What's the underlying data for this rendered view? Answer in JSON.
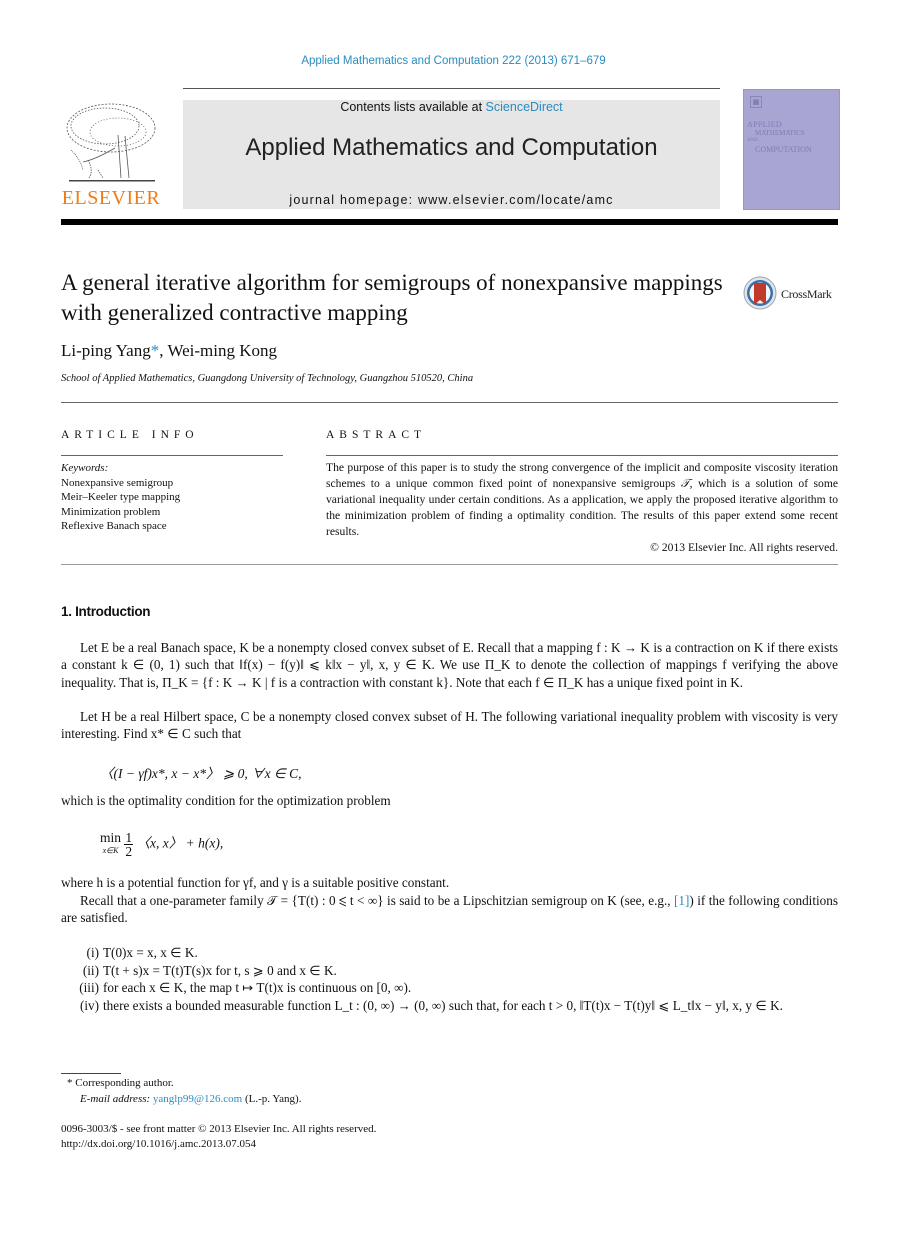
{
  "header": {
    "journal_reference": "Applied Mathematics and Computation 222 (2013) 671–679",
    "contents_prefix": "Contents lists available at ",
    "contents_link": "ScienceDirect",
    "journal_title": "Applied Mathematics and Computation",
    "homepage": "journal homepage: www.elsevier.com/locate/amc",
    "publisher_logo_text": "ELSEVIER",
    "cover": {
      "line1": "APPLIED",
      "line2": "MATHEMATICS",
      "line3": "AND",
      "line4": "COMPUTATION"
    },
    "colors": {
      "link": "#2a8cc0",
      "elsevier_orange": "#f07c17",
      "banner_gray": "#e6e6e6",
      "cover_purple": "#a9a5d3"
    }
  },
  "article": {
    "title": "A general iterative algorithm for semigroups of nonexpansive mappings with generalized contractive mapping",
    "crossmark_label": "CrossMark",
    "authors": {
      "author1": "Li-ping Yang",
      "corresponding_mark": "*",
      "separator": ", ",
      "author2": "Wei-ming Kong"
    },
    "affiliation": "School of Applied Mathematics, Guangdong University of Technology, Guangzhou 510520, China"
  },
  "article_info": {
    "heading": "ARTICLE INFO",
    "keywords_label": "Keywords:",
    "keywords": [
      "Nonexpansive semigroup",
      "Meir–Keeler type mapping",
      "Minimization problem",
      "Reflexive Banach space"
    ]
  },
  "abstract": {
    "heading": "ABSTRACT",
    "text_before_symbol": "The purpose of this paper is to study the strong convergence of the implicit and composite viscosity iteration schemes to a unique common fixed point of nonexpansive semigroups ",
    "symbol": "𝒯",
    "text_after_symbol": ", which is a solution of some variational inequality under certain conditions. As a application, we apply the proposed iterative algorithm to the minimization problem of finding a optimality condition. The results of this paper extend some recent results.",
    "copyright": "© 2013 Elsevier Inc. All rights reserved."
  },
  "introduction": {
    "heading": "1. Introduction",
    "p1": "Let E be a real Banach space, K be a nonempty closed convex subset of E. Recall that a mapping f : K → K is a contraction on K if there exists a constant k ∈ (0, 1) such that ‖f(x) − f(y)‖ ⩽ k‖x − y‖, x, y ∈ K. We use Π_K to denote the collection of mappings f verifying the above inequality. That is, Π_K = {f : K → K | f is a contraction with constant k}. Note that each f ∈ Π_K has a unique fixed point in K.",
    "p2": "Let H be a real Hilbert space, C be a nonempty closed convex subset of H. The following variational inequality problem with viscosity is very interesting. Find x* ∈ C such that",
    "eq1": "〈(I − γf)x*, x − x*〉 ⩾ 0,    ∀x ∈ C,",
    "p3": "which is the optimality condition for the optimization problem",
    "eq2": {
      "operator": "min",
      "subscript": "x∈K",
      "frac_num": "1",
      "frac_den": "2",
      "rest": "〈x, x〉 + h(x),"
    },
    "p4": "where h is a potential function for γf, and γ is a suitable positive constant.",
    "p5_before_ref": "Recall that a one-parameter family 𝒯 = {T(t) : 0 ⩽ t < ∞} is said to be a Lipschitzian semigroup on K (see, e.g., ",
    "p5_ref": "[1]",
    "p5_after_ref": ") if the following conditions are satisfied.",
    "conditions": [
      {
        "num": "(i)",
        "text": "T(0)x = x, x ∈ K."
      },
      {
        "num": "(ii)",
        "text": "T(t + s)x = T(t)T(s)x for t, s ⩾ 0 and x ∈ K."
      },
      {
        "num": "(iii)",
        "text": "for each x ∈ K, the map t ↦ T(t)x is continuous on [0, ∞)."
      },
      {
        "num": "(iv)",
        "text": "there exists a bounded measurable function L_t : (0, ∞) → (0, ∞) such that, for each t > 0, ‖T(t)x − T(t)y‖ ⩽ L_t‖x − y‖, x, y ∈ K."
      }
    ]
  },
  "footnotes": {
    "corresponding": "* Corresponding author.",
    "email_label": "E-mail address: ",
    "email": "yanglp99@126.com",
    "email_suffix": " (L.-p. Yang).",
    "front_matter": "0096-3003/$ - see front matter © 2013 Elsevier Inc. All rights reserved.",
    "doi": "http://dx.doi.org/10.1016/j.amc.2013.07.054"
  }
}
